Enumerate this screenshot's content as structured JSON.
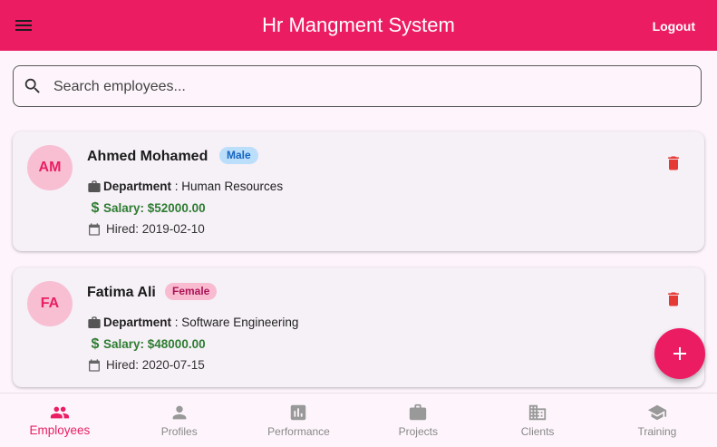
{
  "appbar": {
    "title": "Hr Mangment System",
    "logout_label": "Logout"
  },
  "search": {
    "placeholder": "Search employees...",
    "value": ""
  },
  "employees": [
    {
      "initials": "AM",
      "name": "Ahmed Mohamed",
      "gender": "Male",
      "department_label": "Department",
      "department": " : Human Resources",
      "salary": "Salary: $52000.00",
      "hired": "Hired: 2019-02-10"
    },
    {
      "initials": "FA",
      "name": "Fatima Ali",
      "gender": "Female",
      "department_label": "Department",
      "department": " : Software Engineering",
      "salary": "Salary: $48000.00",
      "hired": "Hired: 2020-07-15"
    }
  ],
  "nav": [
    {
      "label": "Employees",
      "icon": "people-icon",
      "active": true
    },
    {
      "label": "Profiles",
      "icon": "person-icon"
    },
    {
      "label": "Performance",
      "icon": "bar-chart-icon"
    },
    {
      "label": "Projects",
      "icon": "briefcase-icon"
    },
    {
      "label": "Clients",
      "icon": "building-icon"
    },
    {
      "label": "Training",
      "icon": "school-icon"
    }
  ],
  "colors": {
    "primary": "#ec1c63",
    "salary": "#2e7d32",
    "delete": "#e53935",
    "male_badge": "#bbdefb",
    "female_badge": "#f8bbd0"
  }
}
